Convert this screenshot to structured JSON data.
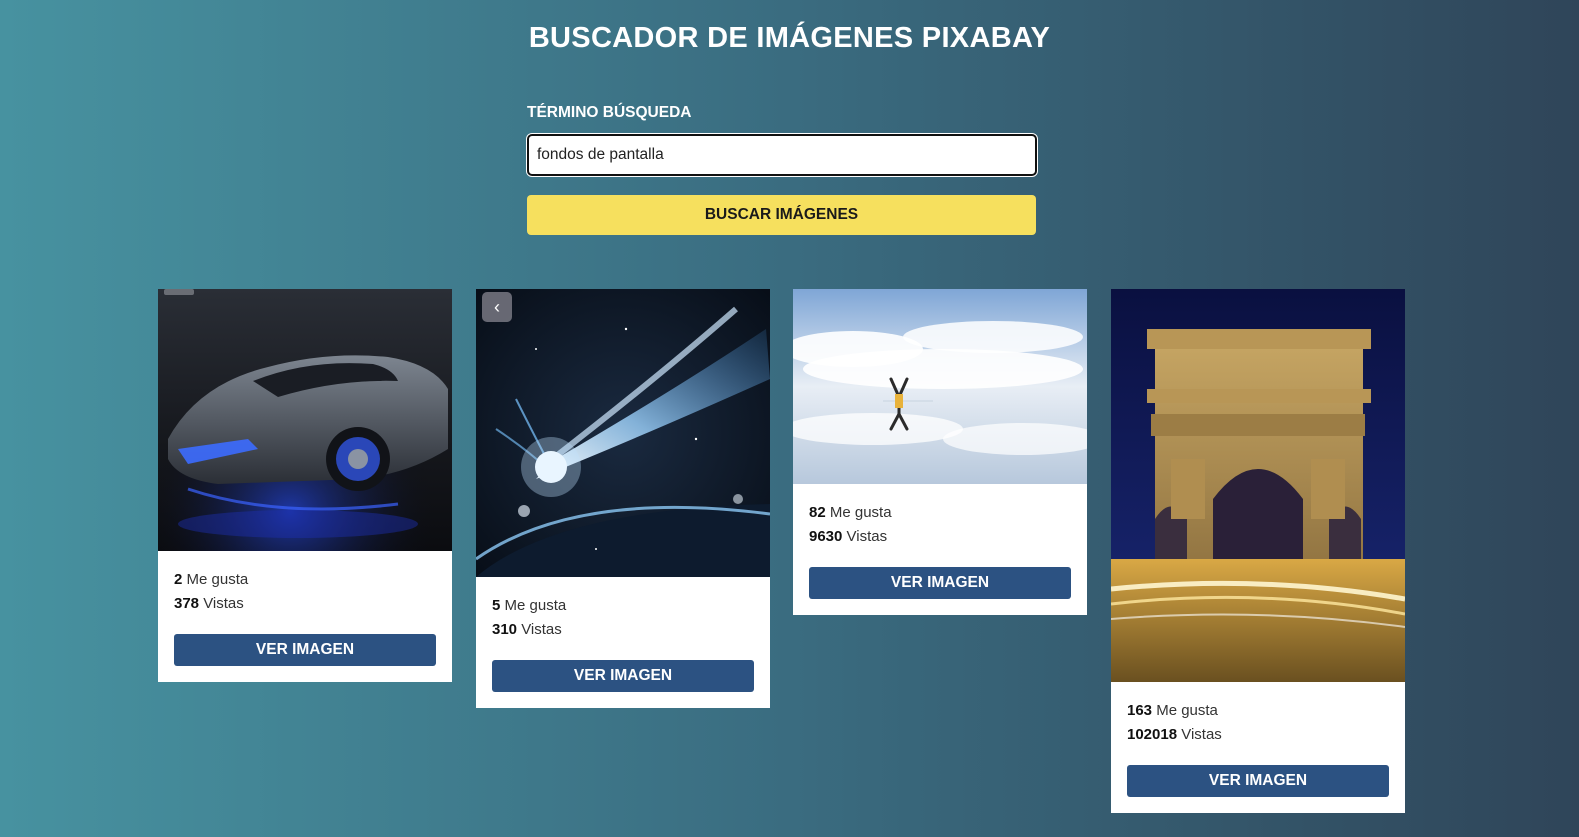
{
  "header": {
    "title": "BUSCADOR DE IMÁGENES PIXABAY"
  },
  "search": {
    "label": "TÉRMINO BÚSQUEDA",
    "value": "fondos de pantalla",
    "button_label": "BUSCAR IMÁGENES"
  },
  "cards": [
    {
      "likes": "2",
      "likes_label": "Me gusta",
      "views": "378",
      "views_label": "Vistas",
      "button_label": "VER IMAGEN",
      "subject": "sports car"
    },
    {
      "likes": "5",
      "likes_label": "Me gusta",
      "views": "310",
      "views_label": "Vistas",
      "button_label": "VER IMAGEN",
      "subject": "comet in space"
    },
    {
      "likes": "82",
      "likes_label": "Me gusta",
      "views": "9630",
      "views_label": "Vistas",
      "button_label": "VER IMAGEN",
      "subject": "person reflected in sky"
    },
    {
      "likes": "163",
      "likes_label": "Me gusta",
      "views": "102018",
      "views_label": "Vistas",
      "button_label": "VER IMAGEN",
      "subject": "arc de triomphe at night"
    }
  ],
  "colors": {
    "search_button": "#f6e05e",
    "view_button": "#2c5282",
    "background_start": "#4792a0",
    "background_end": "#2f4559"
  },
  "icons": {
    "carousel_prev": "chevron-left-icon"
  }
}
